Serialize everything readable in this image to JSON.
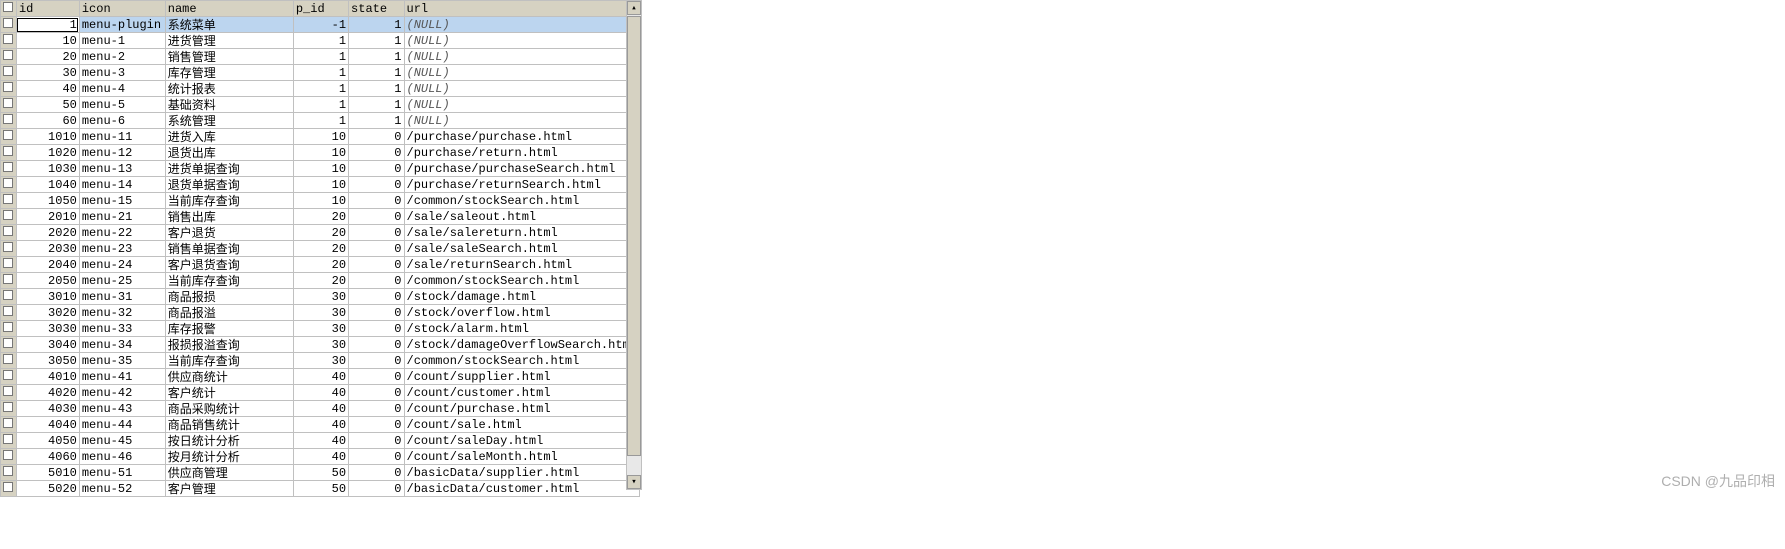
{
  "watermark": "CSDN @九品印相",
  "columns": [
    "id",
    "icon",
    "name",
    "p_id",
    "state",
    "url"
  ],
  "rows": [
    {
      "id": 1,
      "icon": "menu-plugin",
      "name": "系统菜单",
      "p_id": -1,
      "state": 1,
      "url": null,
      "selected": true
    },
    {
      "id": 10,
      "icon": "menu-1",
      "name": "进货管理",
      "p_id": 1,
      "state": 1,
      "url": null
    },
    {
      "id": 20,
      "icon": "menu-2",
      "name": "销售管理",
      "p_id": 1,
      "state": 1,
      "url": null
    },
    {
      "id": 30,
      "icon": "menu-3",
      "name": "库存管理",
      "p_id": 1,
      "state": 1,
      "url": null
    },
    {
      "id": 40,
      "icon": "menu-4",
      "name": "统计报表",
      "p_id": 1,
      "state": 1,
      "url": null
    },
    {
      "id": 50,
      "icon": "menu-5",
      "name": "基础资料",
      "p_id": 1,
      "state": 1,
      "url": null
    },
    {
      "id": 60,
      "icon": "menu-6",
      "name": "系统管理",
      "p_id": 1,
      "state": 1,
      "url": null
    },
    {
      "id": 1010,
      "icon": "menu-11",
      "name": "进货入库",
      "p_id": 10,
      "state": 0,
      "url": "/purchase/purchase.html"
    },
    {
      "id": 1020,
      "icon": "menu-12",
      "name": "退货出库",
      "p_id": 10,
      "state": 0,
      "url": "/purchase/return.html"
    },
    {
      "id": 1030,
      "icon": "menu-13",
      "name": "进货单据查询",
      "p_id": 10,
      "state": 0,
      "url": "/purchase/purchaseSearch.html"
    },
    {
      "id": 1040,
      "icon": "menu-14",
      "name": "退货单据查询",
      "p_id": 10,
      "state": 0,
      "url": "/purchase/returnSearch.html"
    },
    {
      "id": 1050,
      "icon": "menu-15",
      "name": "当前库存查询",
      "p_id": 10,
      "state": 0,
      "url": "/common/stockSearch.html"
    },
    {
      "id": 2010,
      "icon": "menu-21",
      "name": "销售出库",
      "p_id": 20,
      "state": 0,
      "url": "/sale/saleout.html"
    },
    {
      "id": 2020,
      "icon": "menu-22",
      "name": "客户退货",
      "p_id": 20,
      "state": 0,
      "url": "/sale/salereturn.html"
    },
    {
      "id": 2030,
      "icon": "menu-23",
      "name": "销售单据查询",
      "p_id": 20,
      "state": 0,
      "url": "/sale/saleSearch.html"
    },
    {
      "id": 2040,
      "icon": "menu-24",
      "name": "客户退货查询",
      "p_id": 20,
      "state": 0,
      "url": "/sale/returnSearch.html"
    },
    {
      "id": 2050,
      "icon": "menu-25",
      "name": "当前库存查询",
      "p_id": 20,
      "state": 0,
      "url": "/common/stockSearch.html"
    },
    {
      "id": 3010,
      "icon": "menu-31",
      "name": "商品报损",
      "p_id": 30,
      "state": 0,
      "url": "/stock/damage.html"
    },
    {
      "id": 3020,
      "icon": "menu-32",
      "name": "商品报溢",
      "p_id": 30,
      "state": 0,
      "url": "/stock/overflow.html"
    },
    {
      "id": 3030,
      "icon": "menu-33",
      "name": "库存报警",
      "p_id": 30,
      "state": 0,
      "url": "/stock/alarm.html"
    },
    {
      "id": 3040,
      "icon": "menu-34",
      "name": "报损报溢查询",
      "p_id": 30,
      "state": 0,
      "url": "/stock/damageOverflowSearch.html"
    },
    {
      "id": 3050,
      "icon": "menu-35",
      "name": "当前库存查询",
      "p_id": 30,
      "state": 0,
      "url": "/common/stockSearch.html"
    },
    {
      "id": 4010,
      "icon": "menu-41",
      "name": "供应商统计",
      "p_id": 40,
      "state": 0,
      "url": "/count/supplier.html"
    },
    {
      "id": 4020,
      "icon": "menu-42",
      "name": "客户统计",
      "p_id": 40,
      "state": 0,
      "url": "/count/customer.html"
    },
    {
      "id": 4030,
      "icon": "menu-43",
      "name": "商品采购统计",
      "p_id": 40,
      "state": 0,
      "url": "/count/purchase.html"
    },
    {
      "id": 4040,
      "icon": "menu-44",
      "name": "商品销售统计",
      "p_id": 40,
      "state": 0,
      "url": "/count/sale.html"
    },
    {
      "id": 4050,
      "icon": "menu-45",
      "name": "按日统计分析",
      "p_id": 40,
      "state": 0,
      "url": "/count/saleDay.html"
    },
    {
      "id": 4060,
      "icon": "menu-46",
      "name": "按月统计分析",
      "p_id": 40,
      "state": 0,
      "url": "/count/saleMonth.html"
    },
    {
      "id": 5010,
      "icon": "menu-51",
      "name": "供应商管理",
      "p_id": 50,
      "state": 0,
      "url": "/basicData/supplier.html"
    },
    {
      "id": 5020,
      "icon": "menu-52",
      "name": "客户管理",
      "p_id": 50,
      "state": 0,
      "url": "/basicData/customer.html"
    }
  ]
}
